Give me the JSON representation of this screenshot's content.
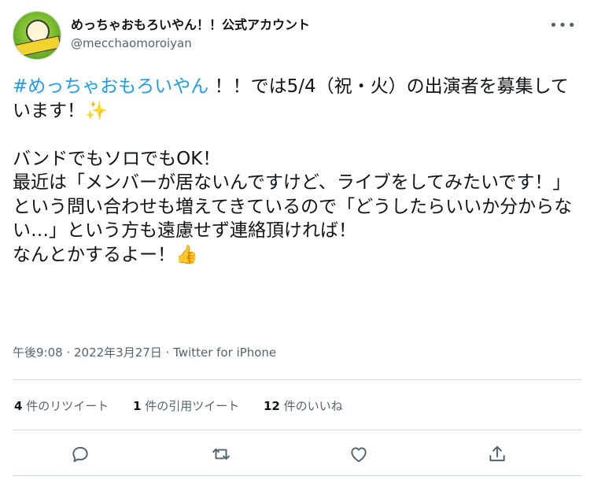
{
  "tweet": {
    "display_name": "めっちゃおもろいやん！！公式アカウント",
    "handle": "@mecchaomoroiyan",
    "more": "•••",
    "hashtag": "#めっちゃおもろいやん",
    "text_after_hashtag": " ！！では5/4（祝・火）の出演者を募集しています！✨\n\nバンドでもソロでもOK！\n最近は「メンバーが居ないんですけど、ライブをしてみたいです！」という問い合わせも増えてきているので「どうしたらいいか分からない…」という方も遠慮せず連絡頂ければ！\nなんとかするよー！👍",
    "timestamp": "午後9:08 · 2022年3月27日 · Twitter for iPhone"
  },
  "stats": {
    "retweets_count": "4",
    "retweets_label": " 件のリツイート",
    "quotes_count": "1",
    "quotes_label": " 件の引用ツイート",
    "likes_count": "12",
    "likes_label": " 件のいいね"
  },
  "actions": {
    "reply_icon": "reply-icon",
    "retweet_icon": "retweet-icon",
    "like_icon": "like-icon",
    "share_icon": "share-icon"
  }
}
